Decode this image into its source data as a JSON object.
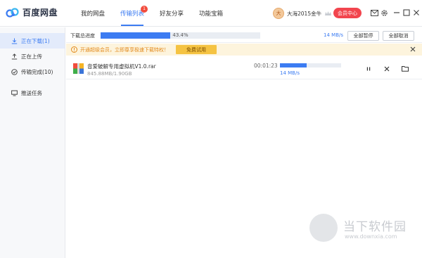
{
  "app": {
    "name": "百度网盘"
  },
  "nav": {
    "tabs": [
      {
        "label": "我的网盘"
      },
      {
        "label": "传输列表",
        "badge": "1"
      },
      {
        "label": "好友分享"
      },
      {
        "label": "功能宝箱"
      }
    ]
  },
  "user": {
    "name": "大海2015金牛",
    "avatar_char": "大"
  },
  "header": {
    "member_center": "会员中心"
  },
  "sidebar": {
    "items": [
      {
        "label": "正在下载(1)"
      },
      {
        "label": "正在上传"
      },
      {
        "label": "传输完成(10)"
      },
      {
        "label": "推送任务"
      }
    ]
  },
  "overall": {
    "label": "下载总进度",
    "percent_text": "43.4%",
    "percent": 43.4,
    "speed": "14 MB/s",
    "pause_all": "全部暂停",
    "cancel_all": "全部取消"
  },
  "banner": {
    "text": "开通超级会员，立即尊享极速下载特权！",
    "button": "免费试用"
  },
  "task": {
    "name": "音爱破解专用虚拟机V1.0.rar",
    "size": "845.88MB/1.90GB",
    "time": "00:01:23",
    "progress": 43.4,
    "speed": "14 MB/s"
  },
  "watermark": {
    "text": "当下软件园",
    "url": "www.downxia.com"
  },
  "colors": {
    "accent": "#3c7cf2",
    "danger": "#f2454e",
    "banner_bg": "#fdf4dd",
    "banner_btn": "#f5c342"
  }
}
